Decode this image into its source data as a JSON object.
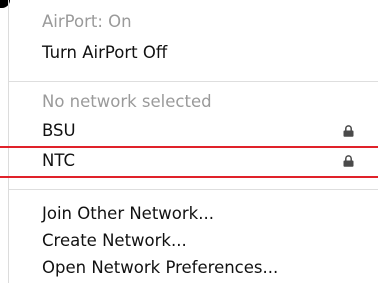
{
  "menu": {
    "status": "AirPort: On",
    "toggle": "Turn AirPort Off",
    "no_network": "No network selected",
    "networks": [
      {
        "name": "BSU",
        "secured": true,
        "lock_icon": "lock-icon"
      },
      {
        "name": "NTC",
        "secured": true,
        "lock_icon": "lock-icon"
      }
    ],
    "join_other": "Join Other Network...",
    "create_network": "Create Network...",
    "open_prefs": "Open Network Preferences..."
  },
  "colors": {
    "annotation_line": "#e0222a",
    "disabled_text": "#9a9a9a",
    "text": "#111111"
  }
}
